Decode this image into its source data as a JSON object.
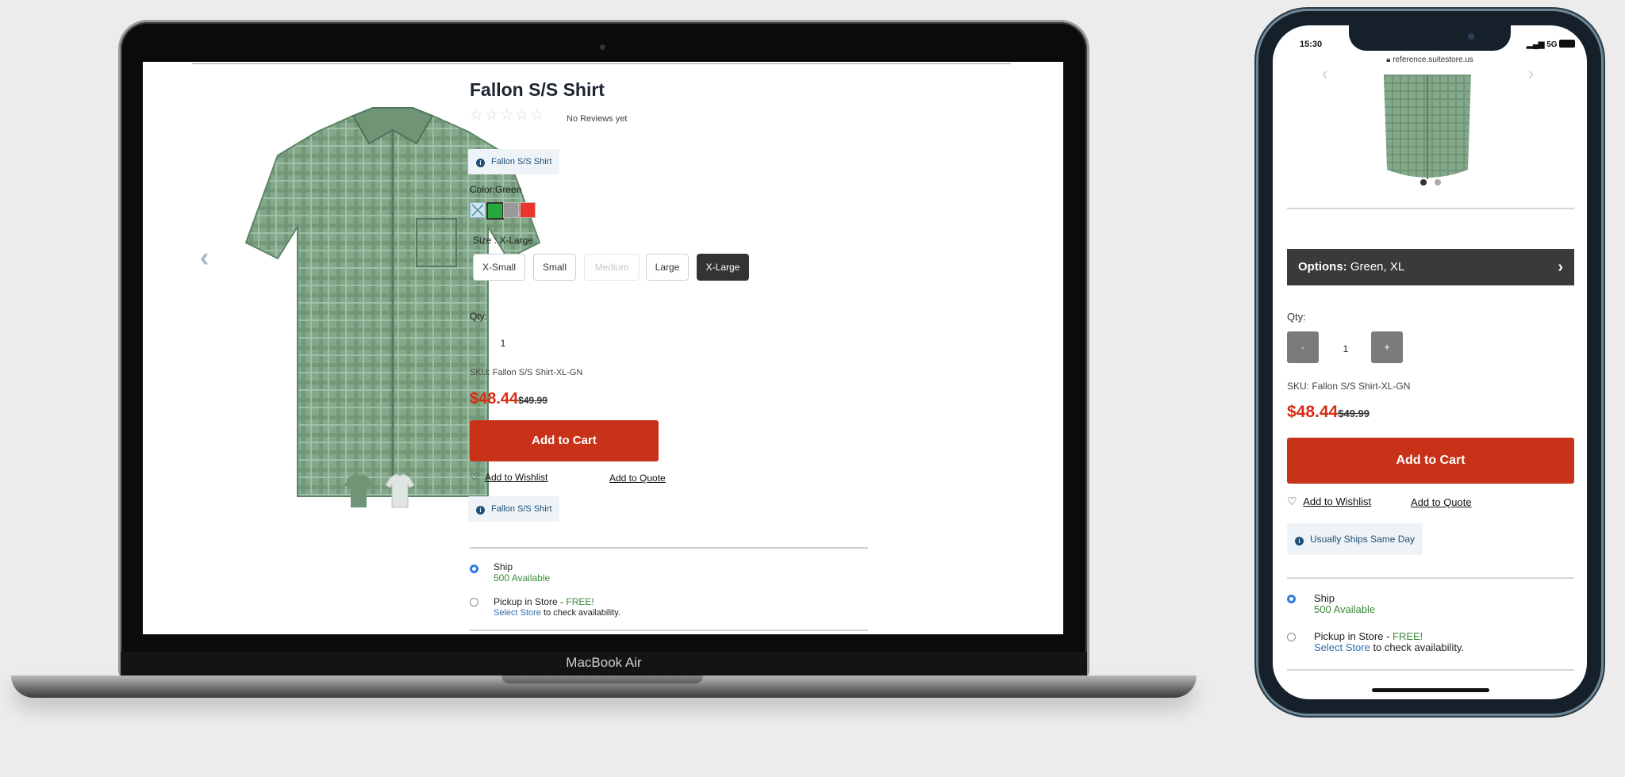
{
  "laptop": {
    "brand": "MacBook Air",
    "product": {
      "title": "Fallon S/S Shirt",
      "reviews": "No Reviews yet",
      "stars": "☆☆☆☆☆",
      "info_badge": "Fallon S/S Shirt",
      "color_label": "Color:Green",
      "size_label": "Size : X-Large",
      "sizes": [
        "X-Small",
        "Small",
        "Medium",
        "Large",
        "X-Large"
      ],
      "qty_label": "Qty:",
      "qty_value": "1",
      "sku": "SKU:  Fallon S/S Shirt-XL-GN",
      "price": "$48.44",
      "old_price": "$49.99",
      "add_to_cart": "Add to Cart",
      "wishlist": "Add to Wishlist",
      "quote": "Add to Quote",
      "info_badge2": "Fallon S/S Shirt",
      "ship_label": "Ship",
      "ship_avail": "500 Available",
      "pickup_label": "Pickup in Store - ",
      "pickup_free": "FREE!",
      "select_store": "Select Store",
      "check_avail": " to check availability.",
      "swatch_colors": [
        "#cfe6ee",
        "#27a83a",
        "#9a9a9a",
        "#e8342b"
      ]
    }
  },
  "phone": {
    "status_time": "15:30",
    "status_network": "5G",
    "url": "reference.suitestore.us",
    "options_label": "Options:",
    "options_value": "Green, XL",
    "qty_label": "Qty:",
    "qty_value": "1",
    "minus": "-",
    "plus": "+",
    "sku": "SKU:  Fallon S/S Shirt-XL-GN",
    "price": "$48.44",
    "old_price": "$49.99",
    "add_to_cart": "Add to Cart",
    "wishlist": "Add to Wishlist",
    "quote": "Add to Quote",
    "ships_badge": "Usually Ships Same Day",
    "ship_label": "Ship",
    "ship_avail": "500 Available",
    "pickup_label": "Pickup in Store - ",
    "pickup_free": "FREE!",
    "select_store": "Select Store",
    "check_avail": " to check availability."
  },
  "colors": {
    "accent_red": "#c73218",
    "price_red": "#d62d12",
    "options_bar": "#3a3a3a",
    "info_blue": "#1e4f76"
  }
}
